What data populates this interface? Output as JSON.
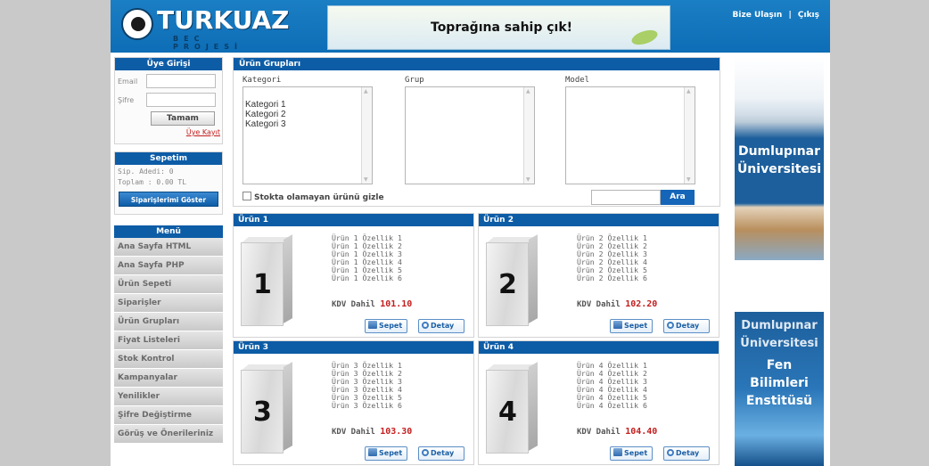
{
  "header": {
    "logo_title": "TURKUAZ",
    "logo_sub": "BEC PROJESİ",
    "banner_text": "Toprağına sahip çık!",
    "link_contact": "Bize Ulaşın",
    "link_sep": "|",
    "link_logout": "Çıkış"
  },
  "login": {
    "title": "Üye Girişi",
    "email_label": "Email",
    "password_label": "Şifre",
    "submit_label": "Tamam",
    "register_label": "Üye Kayıt"
  },
  "cart": {
    "title": "Sepetim",
    "count_line": "Sip. Adedi:  0",
    "total_line": "Toplam :    0.00 TL",
    "orders_button": "Siparişlerimi Göster"
  },
  "menu": {
    "title": "Menü",
    "items": [
      "Ana Sayfa HTML",
      "Ana Sayfa PHP",
      "Ürün Sepeti",
      "Siparişler",
      "Ürün Grupları",
      "Fiyat Listeleri",
      "Stok Kontrol",
      "Kampanyalar",
      "Yenilikler",
      "Şifre Değiştirme",
      "Görüş ve Önerileriniz"
    ]
  },
  "groups": {
    "title": "Ürün Grupları",
    "col_kategori": "Kategori",
    "col_grup": "Grup",
    "col_model": "Model",
    "kategori_options": [
      "Kategori 1",
      "Kategori 2",
      "Kategori 3"
    ],
    "hide_label": "Stokta olamayan ürünü gizle",
    "search_button": "Ara"
  },
  "products": [
    {
      "title": "Ürün 1",
      "box_number": "1",
      "features": [
        "Ürün 1 Özellik 1",
        "Ürün 1 Özellik 2",
        "Ürün 1 Özellik 3",
        "Ürün 1 Özellik 4",
        "Ürün 1 Özellik 5",
        "Ürün 1 Özellik 6"
      ],
      "kdv_label": "KDV Dahil",
      "price": "101.10",
      "cart_button": "Sepet",
      "detail_button": "Detay"
    },
    {
      "title": "Ürün 2",
      "box_number": "2",
      "features": [
        "Ürün 2 Özellik 1",
        "Ürün 2 Özellik 2",
        "Ürün 2 Özellik 3",
        "Ürün 2 Özellik 4",
        "Ürün 2 Özellik 5",
        "Ürün 2 Özellik 6"
      ],
      "kdv_label": "KDV Dahil",
      "price": "102.20",
      "cart_button": "Sepet",
      "detail_button": "Detay"
    },
    {
      "title": "Ürün 3",
      "box_number": "3",
      "features": [
        "Ürün 3 Özellik 1",
        "Ürün 3 Özellik 2",
        "Ürün 3 Özellik 3",
        "Ürün 3 Özellik 4",
        "Ürün 3 Özellik 5",
        "Ürün 3 Özellik 6"
      ],
      "kdv_label": "KDV Dahil",
      "price": "103.30",
      "cart_button": "Sepet",
      "detail_button": "Detay"
    },
    {
      "title": "Ürün 4",
      "box_number": "4",
      "features": [
        "Ürün 4 Özellik 1",
        "Ürün 4 Özellik 2",
        "Ürün 4 Özellik 3",
        "Ürün 4 Özellik 4",
        "Ürün 4 Özellik 5",
        "Ürün 4 Özellik 6"
      ],
      "kdv_label": "KDV Dahil",
      "price": "104.40",
      "cart_button": "Sepet",
      "detail_button": "Detay"
    }
  ],
  "ads": {
    "ad1_line1": "Dumlupınar",
    "ad1_line2": "Üniversitesi",
    "ad2_line1": "Dumlupınar",
    "ad2_line2": "Üniversitesi",
    "ad2_line3": "Fen",
    "ad2_line4": "Bilimleri",
    "ad2_line5": "Enstitüsü"
  },
  "colors": {
    "header_blue": "#0d6db6",
    "title_bar": "#0d5ca6",
    "price_red": "#c41e1e",
    "page_bg": "#c9c9c9"
  }
}
